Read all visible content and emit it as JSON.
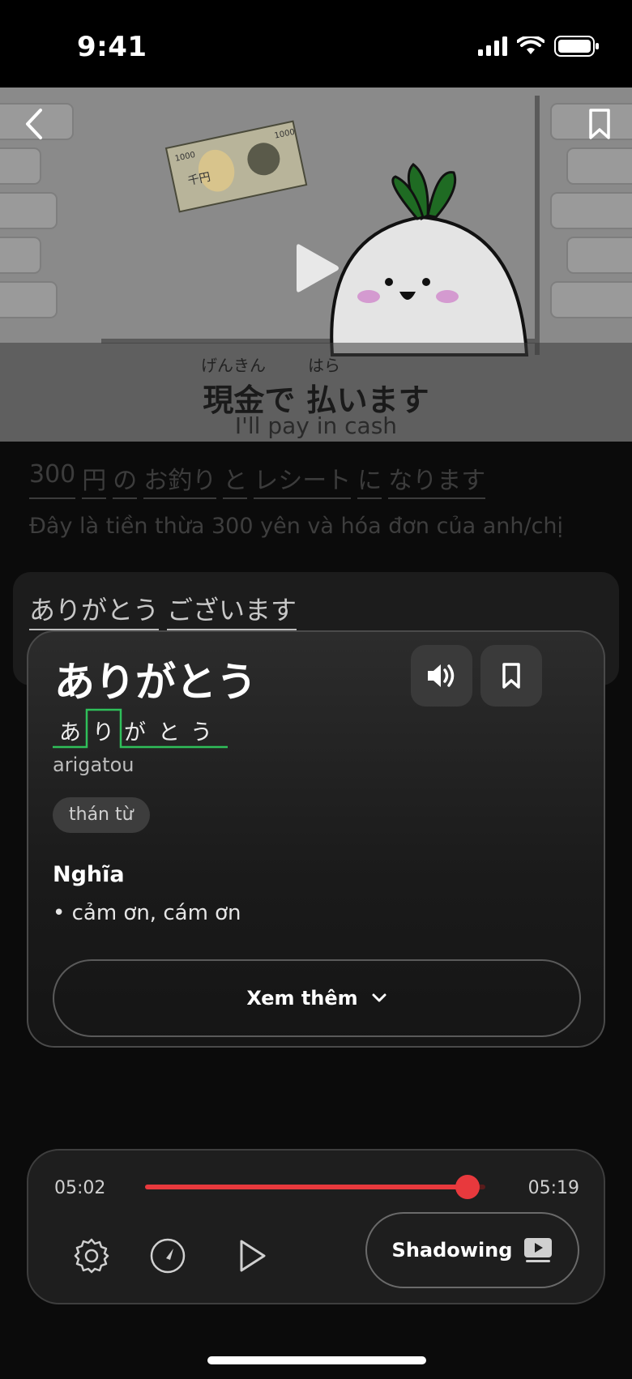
{
  "status": {
    "time": "9:41"
  },
  "video": {
    "subtitle_jp": "現金で 払います",
    "furigana_1": "げんきん",
    "furigana_2": "はら",
    "subtitle_en": "I'll pay in cash",
    "banknote_value": "1000",
    "banknote_text": "千円"
  },
  "prev_sentence": {
    "tokens": [
      "300",
      "円",
      "の",
      "お釣り",
      "と",
      "レシート",
      "に",
      "なります"
    ],
    "translation": "Đây là tiền thừa 300 yên và hóa đơn của anh/chị"
  },
  "current_sentence": {
    "tokens": [
      "ありがとう",
      "ございます"
    ]
  },
  "word_popup": {
    "word": "ありがとう",
    "kana": [
      "あ",
      "り",
      "が",
      "と",
      "う"
    ],
    "romaji": "arigatou",
    "part_of_speech": "thán từ",
    "meaning_heading": "Nghĩa",
    "meaning": "• cảm ơn, cám ơn",
    "more_label": "Xem thêm"
  },
  "player": {
    "current_time": "05:02",
    "total_time": "05:19",
    "progress": 0.947,
    "shadowing_label": "Shadowing",
    "accent_color": "#e8393d"
  },
  "icons": [
    "back-icon",
    "bookmark-icon",
    "play-icon",
    "speaker-icon",
    "chevron-down-icon",
    "gear-icon",
    "speed-icon",
    "video-icon"
  ]
}
